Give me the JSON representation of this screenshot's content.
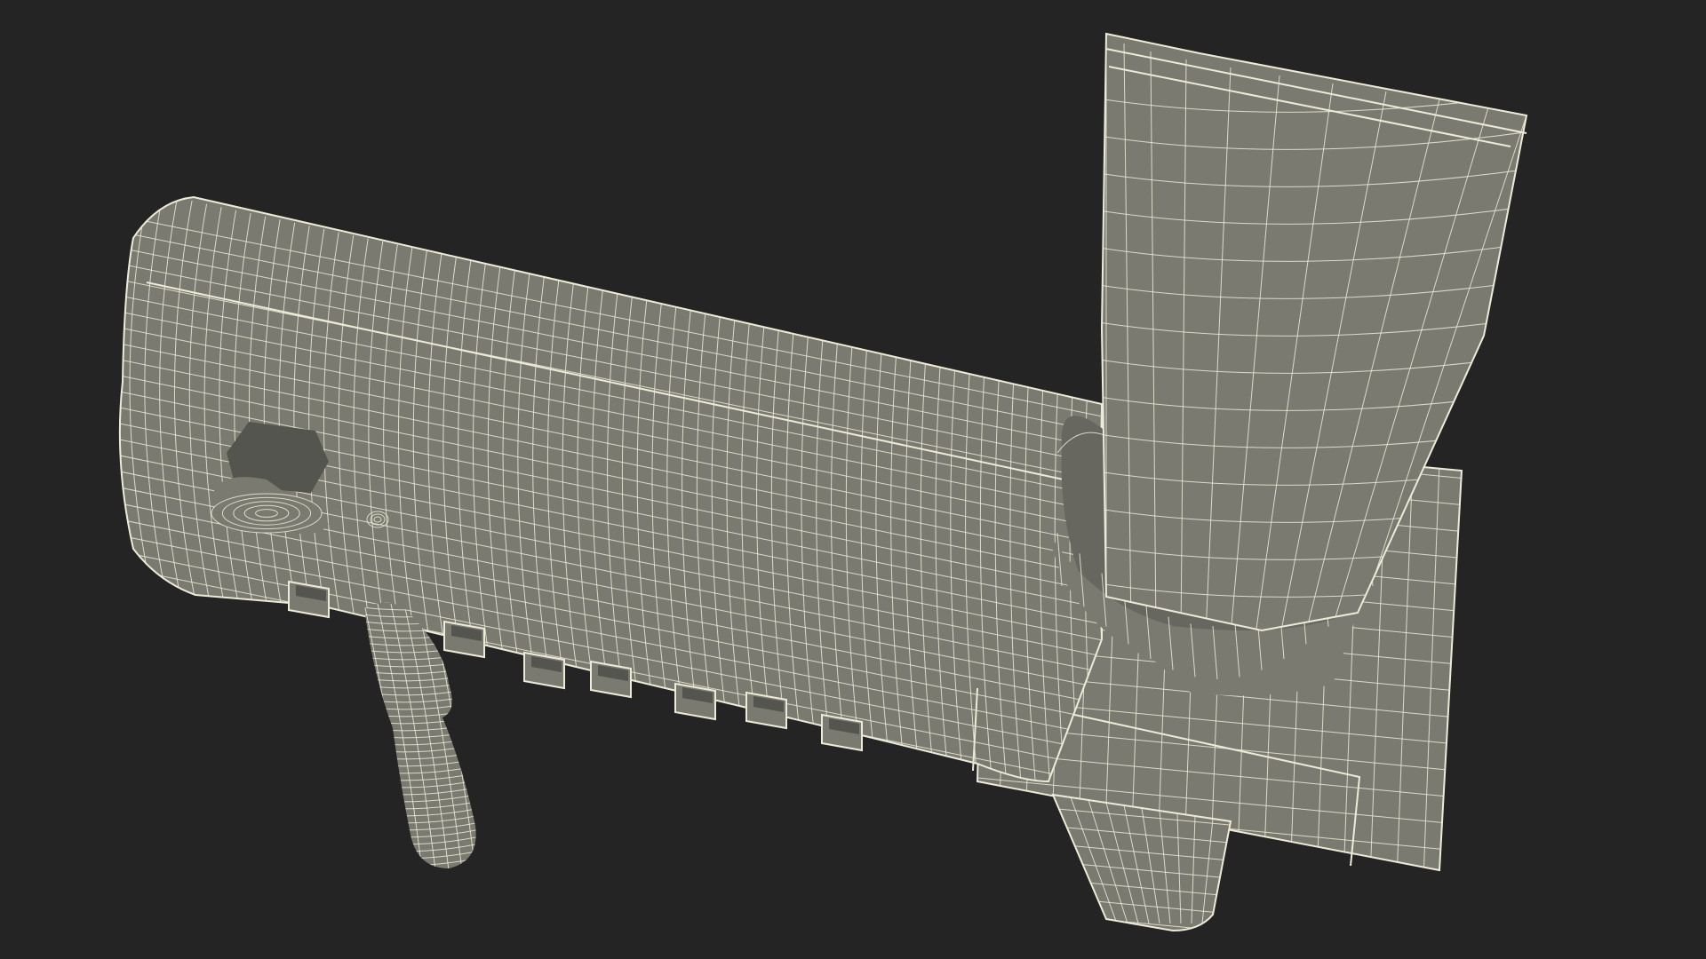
{
  "scene": {
    "background_color": "#242424",
    "surface_color": "#7a7a70",
    "surface_shadow_color": "#676760",
    "surface_dark_color": "#55554f",
    "wire_color": "#ecebd8",
    "objects": [
      {
        "name": "toothpaste-dispenser-body",
        "icon": "cylinder-housing"
      },
      {
        "name": "toothpaste-tube",
        "icon": "tube"
      },
      {
        "name": "toothbrush-holder-slots",
        "icon": "slot"
      },
      {
        "name": "toothbrush",
        "icon": "brush"
      },
      {
        "name": "dispenser-knob",
        "icon": "knob"
      },
      {
        "name": "dispenser-nozzle",
        "icon": "nozzle"
      }
    ]
  }
}
